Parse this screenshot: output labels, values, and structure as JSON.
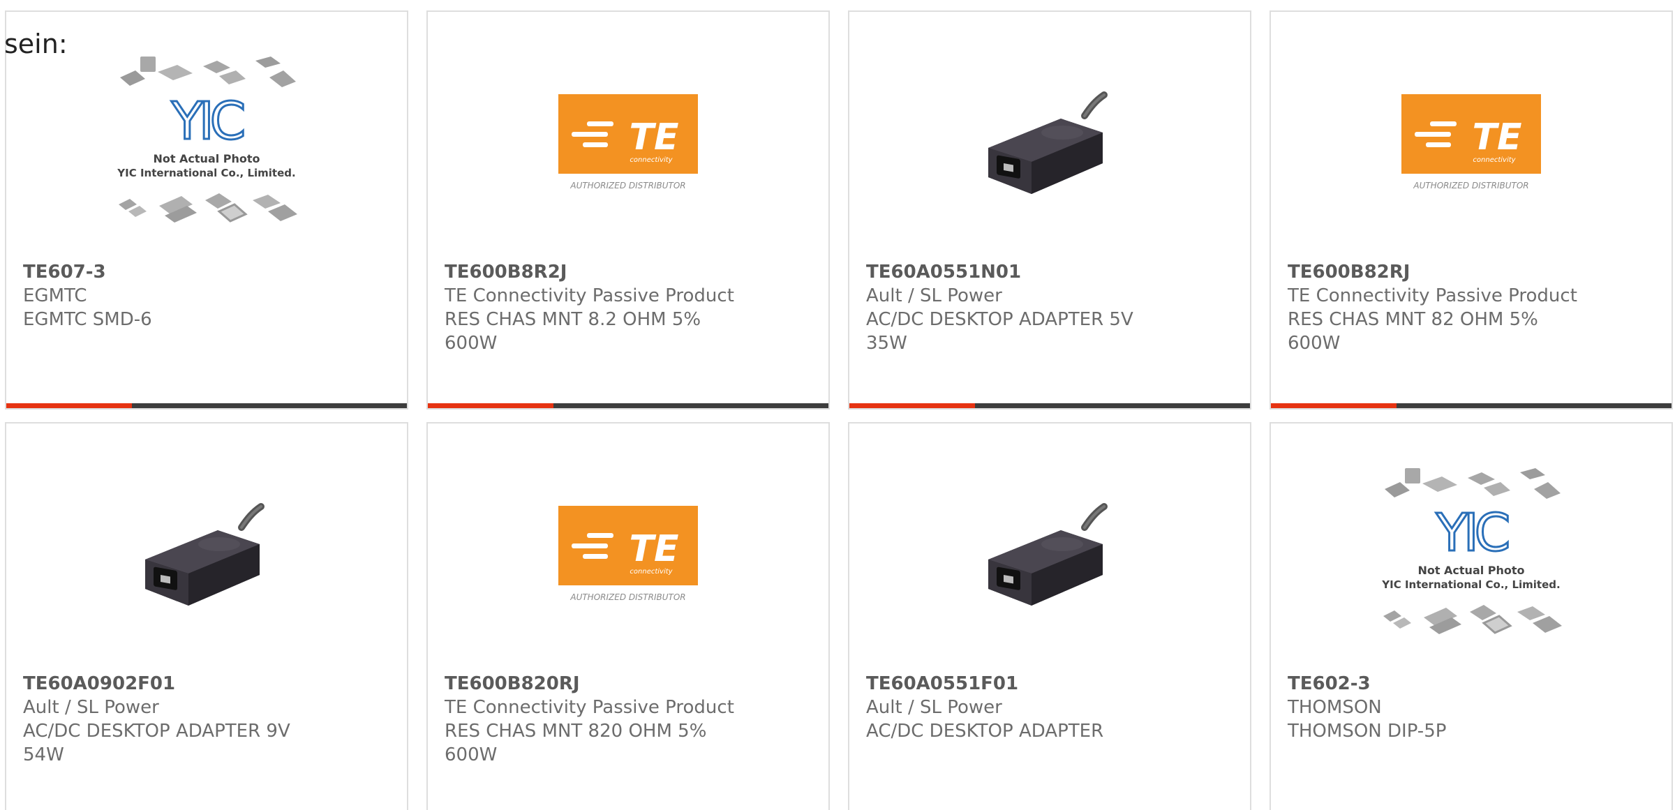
{
  "lead_text": "sein:",
  "products": [
    {
      "part": "TE607-3",
      "manufacturer": "EGMTC",
      "description": "EGMTC SMD-6",
      "image": "yic-placeholder",
      "placeholder_title": "Not Actual Photo",
      "placeholder_company": "YIC International Co., Limited.",
      "placeholder_logo": "YIC"
    },
    {
      "part": "TE600B8R2J",
      "manufacturer": "TE Connectivity Passive Product",
      "description": "RES CHAS MNT 8.2 OHM 5% 600W",
      "image": "te-logo",
      "logo_text": "TE",
      "logo_sub": "connectivity",
      "logo_caption": "AUTHORIZED DISTRIBUTOR"
    },
    {
      "part": "TE60A0551N01",
      "manufacturer": "Ault / SL Power",
      "description": "AC/DC DESKTOP ADAPTER 5V 35W",
      "image": "power-adapter"
    },
    {
      "part": "TE600B82RJ",
      "manufacturer": "TE Connectivity Passive Product",
      "description": "RES CHAS MNT 82 OHM 5% 600W",
      "image": "te-logo",
      "logo_text": "TE",
      "logo_sub": "connectivity",
      "logo_caption": "AUTHORIZED DISTRIBUTOR"
    },
    {
      "part": "TE60A0902F01",
      "manufacturer": "Ault / SL Power",
      "description": "AC/DC DESKTOP ADAPTER 9V 54W",
      "image": "power-adapter"
    },
    {
      "part": "TE600B820RJ",
      "manufacturer": "TE Connectivity Passive Product",
      "description": "RES CHAS MNT 820 OHM 5% 600W",
      "image": "te-logo",
      "logo_text": "TE",
      "logo_sub": "connectivity",
      "logo_caption": "AUTHORIZED DISTRIBUTOR"
    },
    {
      "part": "TE60A0551F01",
      "manufacturer": "Ault / SL Power",
      "description": "AC/DC DESKTOP ADAPTER",
      "image": "power-adapter"
    },
    {
      "part": "TE602-3",
      "manufacturer": "THOMSON",
      "description": "THOMSON DIP-5P",
      "image": "yic-placeholder",
      "placeholder_title": "Not Actual Photo",
      "placeholder_company": "YIC International Co., Limited.",
      "placeholder_logo": "YIC"
    }
  ],
  "colors": {
    "accent": "#e63312",
    "bar": "#3d3d3d",
    "te_orange": "#f39222"
  }
}
